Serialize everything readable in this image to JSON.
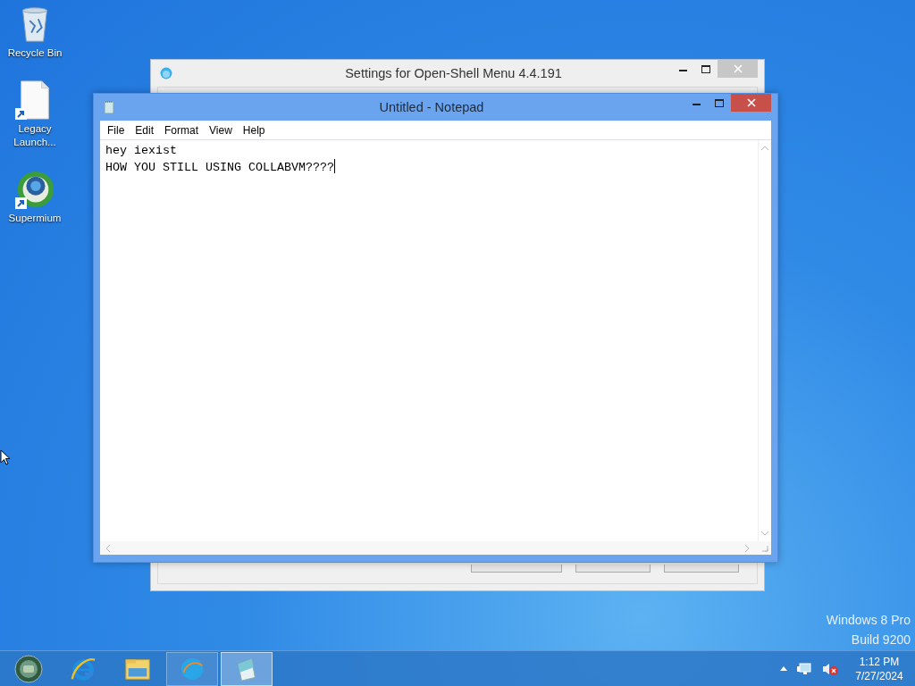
{
  "desktop_icons": [
    {
      "kind": "recycle",
      "label": "Recycle Bin",
      "shortcut": false
    },
    {
      "kind": "document",
      "label": "Legacy Launch...",
      "shortcut": true
    },
    {
      "kind": "globe",
      "label": "Supermium",
      "shortcut": true
    }
  ],
  "settings_window": {
    "title": "Settings for Open-Shell Menu 4.4.191",
    "active": false,
    "buttons": [
      {
        "kind": "dropdown"
      },
      {
        "kind": "plain"
      },
      {
        "kind": "plain"
      }
    ]
  },
  "notepad_window": {
    "title": "Untitled - Notepad",
    "active": true,
    "menu": [
      "File",
      "Edit",
      "Format",
      "View",
      "Help"
    ],
    "lines": [
      "hey iexist",
      "HOW YOU STILL USING COLLABVM????"
    ]
  },
  "os_label": [
    "Windows 8 Pro",
    "Build 9200"
  ],
  "taskbar": {
    "items": [
      {
        "kind": "start",
        "running": false,
        "selected": false
      },
      {
        "kind": "ie",
        "running": false,
        "selected": false
      },
      {
        "kind": "explorer",
        "running": false,
        "selected": false
      },
      {
        "kind": "openshell",
        "running": true,
        "selected": false
      },
      {
        "kind": "notepad",
        "running": true,
        "selected": true
      }
    ],
    "tray": {
      "volume_muted": true
    },
    "time": "1:12 PM",
    "date": "7/27/2024"
  }
}
